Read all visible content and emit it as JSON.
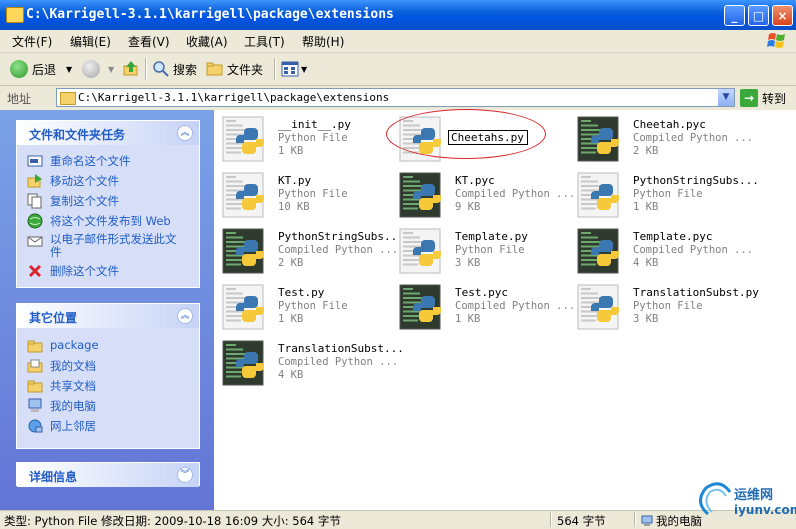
{
  "window": {
    "title": "C:\\Karrigell-3.1.1\\karrigell\\package\\extensions",
    "minimize_label": "_",
    "maximize_label": "□",
    "close_label": "×"
  },
  "menu": [
    "文件(F)",
    "编辑(E)",
    "查看(V)",
    "收藏(A)",
    "工具(T)",
    "帮助(H)"
  ],
  "toolbar": {
    "back_label": "后退",
    "search_label": "搜索",
    "folders_label": "文件夹"
  },
  "address": {
    "label": "地址",
    "value": "C:\\Karrigell-3.1.1\\karrigell\\package\\extensions",
    "go_label": "转到"
  },
  "tasks_panel": {
    "title": "文件和文件夹任务",
    "items": [
      {
        "label": "重命名这个文件",
        "icon": "rename-icon"
      },
      {
        "label": "移动这个文件",
        "icon": "move-icon"
      },
      {
        "label": "复制这个文件",
        "icon": "copy-icon"
      },
      {
        "label": "将这个文件发布到 Web",
        "icon": "publish-web-icon"
      },
      {
        "label": "以电子邮件形式发送此文件",
        "icon": "email-icon"
      },
      {
        "label": "删除这个文件",
        "icon": "delete-icon"
      }
    ]
  },
  "places_panel": {
    "title": "其它位置",
    "items": [
      {
        "label": "package",
        "icon": "folder-icon"
      },
      {
        "label": "我的文档",
        "icon": "my-documents-icon"
      },
      {
        "label": "共享文档",
        "icon": "shared-documents-icon"
      },
      {
        "label": "我的电脑",
        "icon": "my-computer-icon"
      },
      {
        "label": "网上邻居",
        "icon": "network-places-icon"
      }
    ]
  },
  "details_panel": {
    "title": "详细信息"
  },
  "files": [
    {
      "name": "__init__.py",
      "type": "Python File",
      "size": "1 KB",
      "kind": "py"
    },
    {
      "name": "Cheetahs.py",
      "type": "",
      "size": "",
      "kind": "py",
      "renaming": true
    },
    {
      "name": "Cheetah.pyc",
      "type": "Compiled Python ...",
      "size": "2 KB",
      "kind": "pyc"
    },
    {
      "name": "KT.py",
      "type": "Python File",
      "size": "10 KB",
      "kind": "py"
    },
    {
      "name": "KT.pyc",
      "type": "Compiled Python ...",
      "size": "9 KB",
      "kind": "pyc"
    },
    {
      "name": "PythonStringSubs...",
      "type": "Python File",
      "size": "1 KB",
      "kind": "py"
    },
    {
      "name": "PythonStringSubs...",
      "type": "Compiled Python ...",
      "size": "2 KB",
      "kind": "pyc"
    },
    {
      "name": "Template.py",
      "type": "Python File",
      "size": "3 KB",
      "kind": "py"
    },
    {
      "name": "Template.pyc",
      "type": "Compiled Python ...",
      "size": "4 KB",
      "kind": "pyc"
    },
    {
      "name": "Test.py",
      "type": "Python File",
      "size": "1 KB",
      "kind": "py"
    },
    {
      "name": "Test.pyc",
      "type": "Compiled Python ...",
      "size": "1 KB",
      "kind": "pyc"
    },
    {
      "name": "TranslationSubst.py",
      "type": "Python File",
      "size": "3 KB",
      "kind": "py"
    },
    {
      "name": "TranslationSubst...",
      "type": "Compiled Python ...",
      "size": "4 KB",
      "kind": "pyc"
    }
  ],
  "rename_value": "Cheetahs.py",
  "status": {
    "info": "类型: Python File 修改日期: 2009-10-18 16:09 大小: 564 字节",
    "size": "564 字节",
    "zone": "我的电脑"
  },
  "watermark": {
    "brand": "运维网",
    "url": "iyunv.com"
  },
  "colors": {
    "title_bar": "#0054e3",
    "task_pane": "#6375d6",
    "link": "#215dc6",
    "highlight_circle": "#d8262c"
  }
}
